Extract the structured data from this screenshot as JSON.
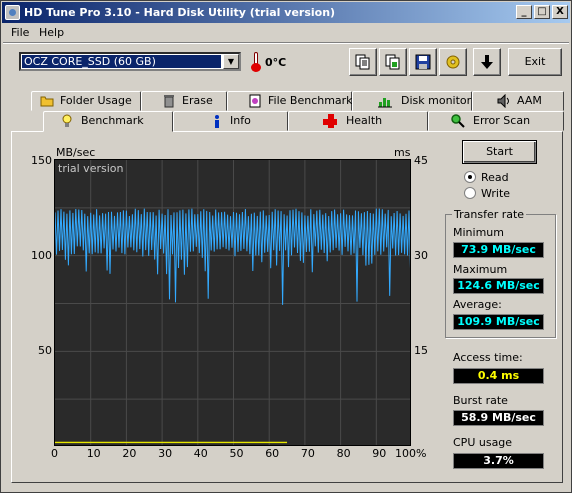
{
  "window": {
    "title": "HD Tune Pro 3.10 - Hard Disk Utility (trial version)",
    "minimize_glyph": "_",
    "maximize_glyph": "□",
    "close_glyph": "X"
  },
  "menu": [
    {
      "label": "File"
    },
    {
      "label": "Help"
    }
  ],
  "toolbar": {
    "drive_selected": "OCZ CORE_SSD (60 GB)",
    "temperature": "0°C",
    "buttons": [
      "copy-text-icon",
      "copy-image-icon",
      "save-icon",
      "options-icon",
      "download-icon"
    ],
    "exit_label": "Exit"
  },
  "tabs": {
    "row1": [
      {
        "label": "Folder Usage",
        "icon": "folder-icon"
      },
      {
        "label": "Erase",
        "icon": "trash-icon"
      },
      {
        "label": "File Benchmark",
        "icon": "file-benchmark-icon"
      },
      {
        "label": "Disk monitor",
        "icon": "disk-monitor-icon"
      },
      {
        "label": "AAM",
        "icon": "speaker-icon"
      }
    ],
    "row2": [
      {
        "label": "Benchmark",
        "icon": "bulb-icon",
        "active": true
      },
      {
        "label": "Info",
        "icon": "info-icon"
      },
      {
        "label": "Health",
        "icon": "health-cross-icon"
      },
      {
        "label": "Error Scan",
        "icon": "magnifier-icon"
      }
    ]
  },
  "graph": {
    "left_unit": "MB/sec",
    "right_unit": "ms",
    "watermark": "trial version",
    "y_left_ticks": [
      "150",
      "100",
      "50"
    ],
    "y_right_ticks": [
      "45",
      "30",
      "15"
    ],
    "x_ticks": [
      "0",
      "10",
      "20",
      "30",
      "40",
      "50",
      "60",
      "70",
      "80",
      "90",
      "100%"
    ],
    "colors": {
      "background": "#2a2a2a",
      "transfer": "#33aaff",
      "access": "#e8e800",
      "grid": "#4a4a4a"
    }
  },
  "chart_data": {
    "type": "line",
    "xlabel": "",
    "ylabel": "MB/sec",
    "y2label": "ms",
    "xlim": [
      0,
      100
    ],
    "ylim": [
      0,
      150
    ],
    "y2lim": [
      0,
      45
    ],
    "series": [
      {
        "name": "",
        "axis": "left",
        "summary": {
          "min": 73.9,
          "max": 124.6,
          "avg": 109.9
        }
      },
      {
        "name": "",
        "axis": "right",
        "value_ms": 0.4,
        "x_end": 65
      }
    ]
  },
  "controls": {
    "start_label": "Start",
    "read_label": "Read",
    "write_label": "Write",
    "read_selected": true
  },
  "results": {
    "transfer_rate_title": "Transfer rate",
    "minimum_label": "Minimum",
    "minimum_value": "73.9 MB/sec",
    "maximum_label": "Maximum",
    "maximum_value": "124.6 MB/sec",
    "average_label": "Average:",
    "average_value": "109.9 MB/sec",
    "access_label": "Access time:",
    "access_value": "0.4 ms",
    "burst_label": "Burst rate",
    "burst_value": "58.9 MB/sec",
    "cpu_label": "CPU usage",
    "cpu_value": "3.7%"
  }
}
